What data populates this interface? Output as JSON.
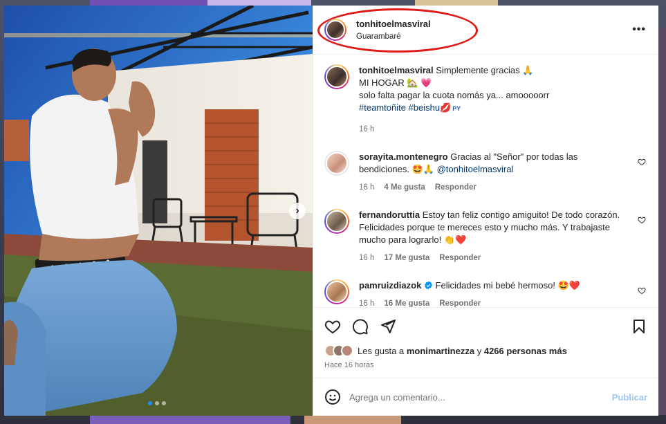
{
  "post": {
    "username": "tonhitoelmasviral",
    "location": "Guarambaré",
    "caption": {
      "username": "tonhitoelmasviral",
      "line1": "Simplemente gracias 🙏",
      "line2": "MI HOGAR 🏡 💗",
      "line3": "solo falta pagar la cuota nomás ya... amooooorr",
      "hashtags": "#teamtoñite #beishu",
      "suffix": "💋",
      "flag_text": "PY",
      "time": "16 h"
    },
    "more_label": "•••"
  },
  "comments": [
    {
      "username": "sorayita.montenegro",
      "text": "Gracias al \"Señor\" por todas las bendiciones. 🤩🙏",
      "mention": "@tonhitoelmasviral",
      "time": "16 h",
      "likes": "4 Me gusta",
      "reply": "Responder"
    },
    {
      "username": "fernandoruttia",
      "text": "Estoy tan feliz contigo amiguito! De todo corazón. Felicidades porque te mereces esto y mucho más. Y trabajaste mucho para lograrlo! 👏❤️",
      "time": "16 h",
      "likes": "17 Me gusta",
      "reply": "Responder"
    },
    {
      "username": "pamruizdiazok",
      "verified": true,
      "text": "Felicidades mi bebé hermoso! 🤩❤️",
      "time": "16 h",
      "likes": "16 Me gusta",
      "reply": "Responder"
    }
  ],
  "likes": {
    "prefix": "Les gusta a",
    "user": "monimartinezza",
    "connector": "y",
    "others": "4266 personas más",
    "ago": "Hace 16 horas"
  },
  "comment_box": {
    "placeholder": "Agrega un comentario...",
    "publish": "Publicar"
  },
  "carousel": {
    "next_label": "›",
    "current_index": 1,
    "total": 3
  },
  "icons": {
    "like": "heart-icon",
    "comment": "comment-icon",
    "share": "paper-plane-icon",
    "save": "bookmark-icon",
    "emoji": "smiley-icon"
  },
  "colors": {
    "link_blue": "#00376b",
    "publish_disabled": "#9ec6f5",
    "annotation_red": "#e01919"
  }
}
